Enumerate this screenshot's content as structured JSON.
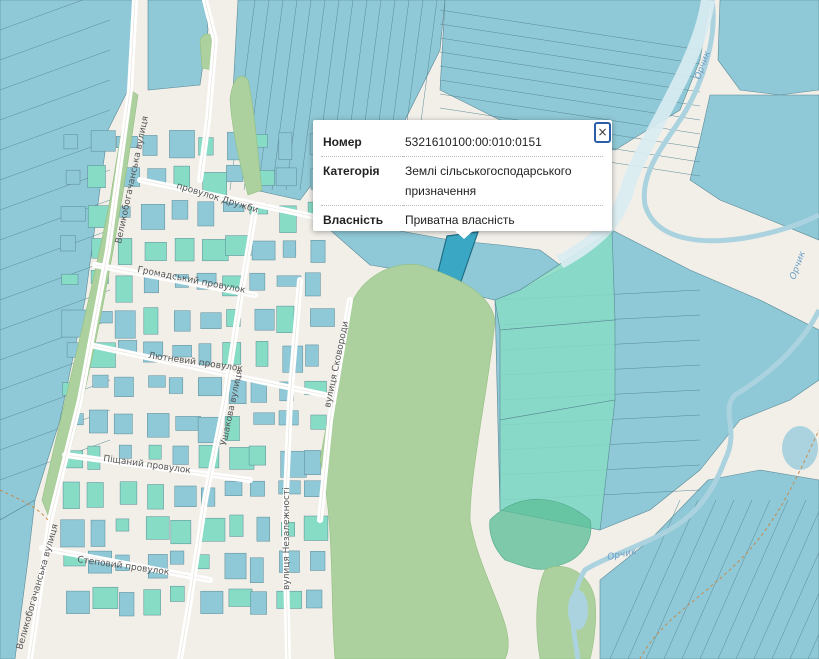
{
  "map": {
    "colors": {
      "land": "#f2efe9",
      "parcel": "#8fc8d6",
      "parcel_stroke": "#5b8a96",
      "parcel_alt": "#87dcc6",
      "selected_parcel": "#3aa8c4",
      "forest": "#add19e",
      "road": "#ffffff",
      "river": "#aad3df"
    },
    "street_labels": {
      "druzhby": "провулок Дружби",
      "hromadskyi": "Громадський провулок",
      "liutnevyi": "Лютневий провулок",
      "pishchanyi": "Піщаний провулок",
      "stepovyi": "Степовий провулок",
      "skovorody": "вулиця Сковороди",
      "ushakova": "Ушакова вулиця",
      "nezalezhnosti": "вулиця Незалежності",
      "velykobohachanska_1": "Великобогачанська вулиця",
      "velykobohachanska_2": "Великобогачанська вулиця"
    },
    "river_labels": {
      "orchyk_1": "Орчик",
      "orchyk_2": "Орчик",
      "orchyk_3": "Орчик"
    }
  },
  "popup": {
    "close_label": "×",
    "rows": [
      {
        "key": "Номер",
        "value": "5321610100:00:010:0151"
      },
      {
        "key": "Категорія",
        "value": "Землі сільськогосподарського призначення"
      },
      {
        "key": "Власність",
        "value": "Приватна власність"
      }
    ]
  }
}
